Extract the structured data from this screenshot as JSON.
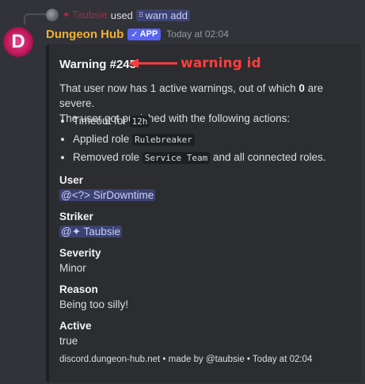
{
  "reply": {
    "username": "Taubsie",
    "sparkle": "✦",
    "used_text": "used",
    "command": "warn add",
    "command_icon": "slash-command-icon"
  },
  "message": {
    "bot_name": "Dungeon Hub",
    "avatar_letter": "D",
    "app_badge": "APP",
    "app_check": "✓",
    "timestamp": "Today at 02:04"
  },
  "embed": {
    "title": "Warning #245",
    "annotation": "warning id",
    "annotation_color": "#ff3d3d",
    "description_line1_pre": "That user now has 1 active warnings, out of which ",
    "description_bold": "0",
    "description_line1_post": " are severe.",
    "description_line2": "The user got punished with the following actions:",
    "actions": [
      {
        "pre": "Timeout for ",
        "code": "12h",
        "post": ""
      },
      {
        "pre": "Applied role ",
        "code": "Rulebreaker",
        "post": ""
      },
      {
        "pre": "Removed role ",
        "code": "Service Team",
        "post": " and all connected roles."
      }
    ],
    "fields": [
      {
        "name": "User",
        "mention": "@<?> SirDowntime"
      },
      {
        "name": "Striker",
        "mention": "@✦ Taubsie"
      },
      {
        "name": "Severity",
        "value": "Minor"
      },
      {
        "name": "Reason",
        "value": "Being too silly!"
      },
      {
        "name": "Active",
        "value": "true"
      }
    ],
    "footer": "discord.dungeon-hub.net • made by @taubsie • Today at 02:04"
  }
}
